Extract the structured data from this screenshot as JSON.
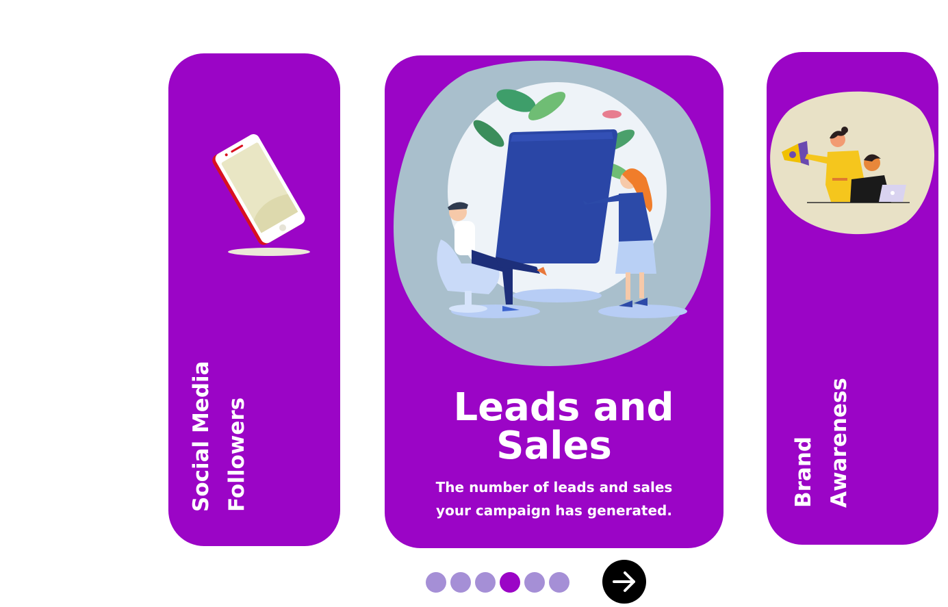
{
  "carousel": {
    "cards": [
      {
        "id": "social-media",
        "title_lines": [
          "Social Media",
          "Followers"
        ],
        "illustration": "smartphone-illustration"
      },
      {
        "id": "leads-sales",
        "title_lines": [
          "Leads and",
          "Sales"
        ],
        "description_lines": [
          "The number of leads and sales",
          "your campaign has generated."
        ],
        "illustration": "dashboard-meeting-illustration"
      },
      {
        "id": "brand-awareness",
        "title_lines": [
          "Brand",
          "Awareness"
        ],
        "illustration": "megaphone-team-illustration"
      }
    ],
    "pagination": {
      "total": 6,
      "active_index": 3
    },
    "next_icon": "arrow-right-icon"
  },
  "colors": {
    "card": "#9b05c6",
    "dot_inactive": "#a58fd6",
    "dot_active": "#9b05c6",
    "next_button": "#000000",
    "text": "#ffffff"
  }
}
